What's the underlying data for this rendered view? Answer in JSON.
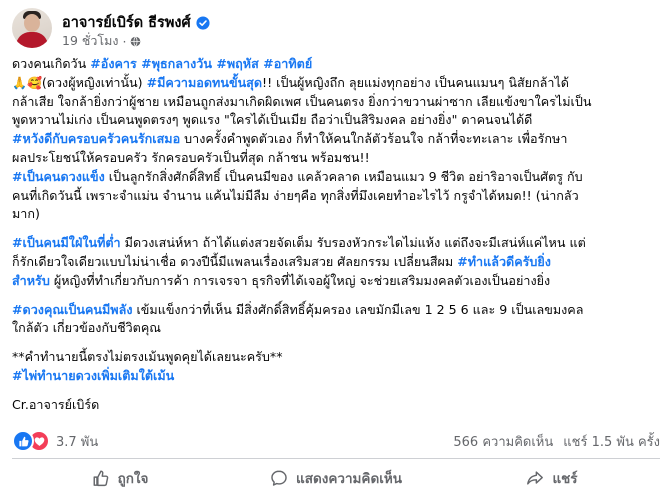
{
  "author": {
    "name": "อาจารย์เบิร์ด ธีรพงศ์"
  },
  "meta": {
    "time": "19 ชั่วโมง"
  },
  "post": {
    "l1_prefix": "ดวงคนเกิดวัน ",
    "l1_tag": "#อังคาร #พุธกลางวัน #พฤหัส #อาทิตย์",
    "l2_emoji": "🙏🥰",
    "l2_text": "(ดวงผู้หญิงเท่านั้น) ",
    "l2_tag": "#มีความอดทนขั้นสุด",
    "l2_rest": "!! เป็นผู้หญิงถึก ลุยแม่งทุกอย่าง เป็นคนแมนๆ นิสัยกล้าได้",
    "l3": "กล้าเสีย ใจกล้ายิ่งกว่าผู้ชาย เหมือนถูกส่งมาเกิดผิดเพศ เป็นคนตรง ยิ่งกว่าขวานผ่าซาก เลียแข้งขาใครไม่เป็น",
    "l4": "พูดหวานไม่เก่ง เป็นคนพูดตรงๆ พูดแรง \"ใครได้เป็นเมีย ถือว่าเป็นสิริมงคล อย่างยิ่ง\" ดาคนจนได้ดี",
    "l5_tag": "#หวังดีกับครอบครัวคนรักเสมอ",
    "l5_rest": " บางครั้งคำพูดตัวเอง ก็ทำให้คนใกล้ตัวร้อนใจ กล้าที่จะทะเลาะ เพื่อรักษา",
    "l6": "ผลประโยชน์ให้ครอบครัว รักครอบครัวเป็นที่สุด กล้าชน พร้อมชน!!",
    "l7_tag": "#เป็นคนดวงแข็ง",
    "l7_rest": " เป็นลูกรักสิ่งศักดิ์สิทธิ์ เป็นคนมีของ แคล้วคลาด เหมือนแมว 9 ชีวิต อย่าริอาจเป็นศัตรู กับ",
    "l8": "คนที่เกิดวันนี้ เพราะจำแม่น จำนาน แค้นไม่มีลืม ง่ายๆคือ ทุกสิ่งที่มึงเคยทำอะไรไว้ กรูจำได้หมด!! (น่ากลัว",
    "l9": "มาก)",
    "l10_tag": "#เป็นคนมีใฝ่ในที่ต่ำ",
    "l10_rest": " มีดวงเสน่ห์หา ถ้าได้แต่งสวยจัดเต็ม รับรองหัวกระไดไม่แห้ง แต่ถึงจะมีเสน่ห์แค่ไหน แต่",
    "l11_text": "ก็รักเดียวใจเดียวแบบไม่น่าเชื่อ ดวงปีนี้มีแพลนเรื่องเสริมสวย ศัลยกรรม เปลี่ยนสีผม ",
    "l11_tag": "#ทำแล้วดีครับยิ่ง",
    "l12_tag": "สำหรับ",
    "l12_rest": " ผู้หญิงที่ทำเกี่ยวกับการค้า การเจรจา ธุรกิจที่ได้เจอผู้ใหญ่ จะช่วยเสริมมงคลตัวเองเป็นอย่างยิ่ง",
    "l13_tag": "#ดวงคุณเป็นคนมีพลัง",
    "l13_rest": " เข้มแข็งกว่าที่เห็น มีสิ่งศักดิ์สิทธิ์คุ้มครอง เลขมักมีเลข 1 2 5 6 และ 9 เป็นเลขมงคล",
    "l14": "ใกล้ตัว เกี่ยวข้องกับชีวิตคุณ",
    "l15": "**คำทำนายนี้ตรงไม่ตรงเม้นพูดคุยได้เลยนะครับ**",
    "l16_tag": "#ไพ่ทำนายดวงเพิ่มเติมใต้เม้น",
    "l17": "Cr.อาจารย์เบิร์ด"
  },
  "stats": {
    "reactions_count": "3.7 พัน",
    "comments": "566 ความคิดเห็น",
    "shares": "แชร์ 1.5 พัน ครั้ง"
  },
  "actions": {
    "like_label": "ถูกใจ",
    "comment_label": "แสดงความคิดเห็น",
    "share_label": "แชร์"
  },
  "colors": {
    "accent": "#1877f2",
    "secondary_text": "#65676b",
    "love": "#f33e58"
  }
}
